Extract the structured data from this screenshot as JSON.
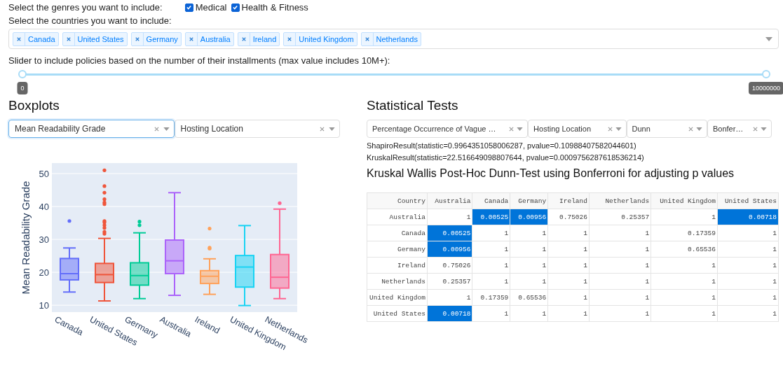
{
  "genres": {
    "label": "Select the genres you want to include:",
    "options": [
      {
        "label": "Medical",
        "checked": true
      },
      {
        "label": "Health & Fitness",
        "checked": true
      }
    ]
  },
  "countries": {
    "label": "Select the countries you want to include:",
    "tags": [
      "Canada",
      "United States",
      "Germany",
      "Australia",
      "Ireland",
      "United Kingdom",
      "Netherlands"
    ]
  },
  "slider": {
    "label": "Slider to include policies based on the number of their installments (max value includes 10M+):",
    "thumbs": [
      {
        "level": 0,
        "tooltip": "0"
      },
      {
        "level": 1,
        "tooltip": "10000000"
      }
    ]
  },
  "boxplots": {
    "title": "Boxplots",
    "dropdowns": [
      {
        "value": "Mean Readability Grade",
        "focused": true
      },
      {
        "value": "Hosting Location",
        "focused": false
      }
    ],
    "plot": {
      "kind": "boxplot",
      "ylabel": "Mean Readability Grade",
      "yticks": [
        "50",
        "40",
        "30",
        "20",
        "10"
      ],
      "categories": [
        {
          "name": "Canada",
          "color": "#636efa"
        },
        {
          "name": "United States",
          "color": "#ef553b"
        },
        {
          "name": "Germany",
          "color": "#00cc96"
        },
        {
          "name": "Australia",
          "color": "#ab63fa"
        },
        {
          "name": "Ireland",
          "color": "#ffa15a"
        },
        {
          "name": "United Kingdom",
          "color": "#19d3f3"
        },
        {
          "name": "Netherlands",
          "color": "#ff6692"
        }
      ]
    }
  },
  "statistical_tests": {
    "title": "Statistical Tests",
    "dropdowns": [
      {
        "value": "Percentage Occurrence of Vague …"
      },
      {
        "value": "Hosting Location"
      },
      {
        "value": "Dunn"
      },
      {
        "value": "Bonfer…"
      }
    ],
    "results": [
      "ShapiroResult(statistic=0.9964351058006287, pvalue=0.10988407582044601)",
      "KruskalResult(statistic=22.516649098807644, pvalue=0.0009756287618536214)"
    ],
    "table_title": "Kruskal Wallis Post-Hoc Dunn-Test using Bonferroni for adjusting p values",
    "table": {
      "columns": [
        "Country",
        "Australia",
        "Canada",
        "Germany",
        "Ireland",
        "Netherlands",
        "United Kingdom",
        "United States"
      ],
      "rows": [
        {
          "cells": [
            {
              "text": "Australia",
              "highlighted": false
            },
            {
              "text": "1",
              "highlighted": false
            },
            {
              "text": "0.00525",
              "highlighted": true
            },
            {
              "text": "0.00956",
              "highlighted": true
            },
            {
              "text": "0.75026",
              "highlighted": false
            },
            {
              "text": "0.25357",
              "highlighted": false
            },
            {
              "text": "1",
              "highlighted": false
            },
            {
              "text": "0.00718",
              "highlighted": true
            }
          ]
        },
        {
          "cells": [
            {
              "text": "Canada",
              "highlighted": false
            },
            {
              "text": "0.00525",
              "highlighted": true
            },
            {
              "text": "1",
              "highlighted": false
            },
            {
              "text": "1",
              "highlighted": false
            },
            {
              "text": "1",
              "highlighted": false
            },
            {
              "text": "1",
              "highlighted": false
            },
            {
              "text": "0.17359",
              "highlighted": false
            },
            {
              "text": "1",
              "highlighted": false
            }
          ]
        },
        {
          "cells": [
            {
              "text": "Germany",
              "highlighted": false
            },
            {
              "text": "0.00956",
              "highlighted": true
            },
            {
              "text": "1",
              "highlighted": false
            },
            {
              "text": "1",
              "highlighted": false
            },
            {
              "text": "1",
              "highlighted": false
            },
            {
              "text": "1",
              "highlighted": false
            },
            {
              "text": "0.65536",
              "highlighted": false
            },
            {
              "text": "1",
              "highlighted": false
            }
          ]
        },
        {
          "cells": [
            {
              "text": "Ireland",
              "highlighted": false
            },
            {
              "text": "0.75026",
              "highlighted": false
            },
            {
              "text": "1",
              "highlighted": false
            },
            {
              "text": "1",
              "highlighted": false
            },
            {
              "text": "1",
              "highlighted": false
            },
            {
              "text": "1",
              "highlighted": false
            },
            {
              "text": "1",
              "highlighted": false
            },
            {
              "text": "1",
              "highlighted": false
            }
          ]
        },
        {
          "cells": [
            {
              "text": "Netherlands",
              "highlighted": false
            },
            {
              "text": "0.25357",
              "highlighted": false
            },
            {
              "text": "1",
              "highlighted": false
            },
            {
              "text": "1",
              "highlighted": false
            },
            {
              "text": "1",
              "highlighted": false
            },
            {
              "text": "1",
              "highlighted": false
            },
            {
              "text": "1",
              "highlighted": false
            },
            {
              "text": "1",
              "highlighted": false
            }
          ]
        },
        {
          "cells": [
            {
              "text": "United Kingdom",
              "highlighted": false
            },
            {
              "text": "1",
              "highlighted": false
            },
            {
              "text": "0.17359",
              "highlighted": false
            },
            {
              "text": "0.65536",
              "highlighted": false
            },
            {
              "text": "1",
              "highlighted": false
            },
            {
              "text": "1",
              "highlighted": false
            },
            {
              "text": "1",
              "highlighted": false
            },
            {
              "text": "1",
              "highlighted": false
            }
          ]
        },
        {
          "cells": [
            {
              "text": "United States",
              "highlighted": false
            },
            {
              "text": "0.00718",
              "highlighted": true
            },
            {
              "text": "1",
              "highlighted": false
            },
            {
              "text": "1",
              "highlighted": false
            },
            {
              "text": "1",
              "highlighted": false
            },
            {
              "text": "1",
              "highlighted": false
            },
            {
              "text": "1",
              "highlighted": false
            },
            {
              "text": "1",
              "highlighted": false
            }
          ]
        }
      ]
    }
  }
}
